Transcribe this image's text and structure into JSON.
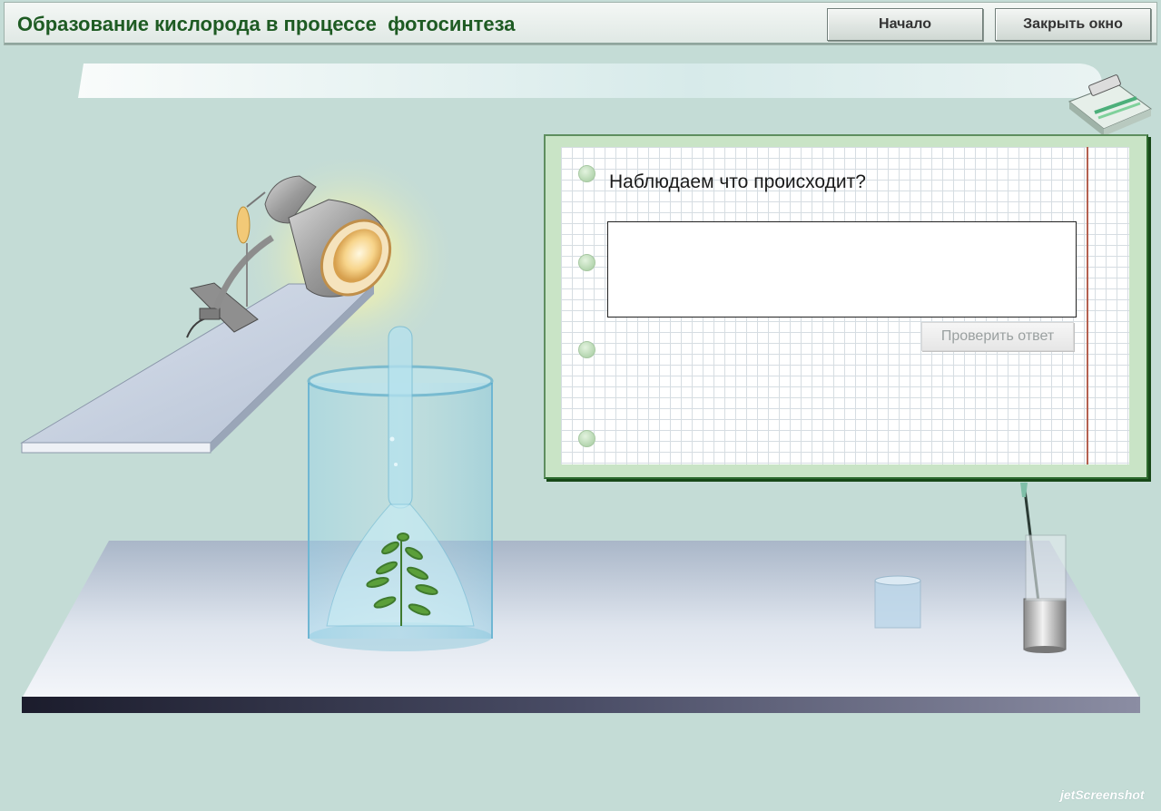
{
  "header": {
    "title": "Образование кислорода в процессе  фотосинтеза",
    "start_label": "Начало",
    "close_label": "Закрыть окно"
  },
  "notebook": {
    "question": "Наблюдаем что происходит?",
    "answer_value": "",
    "check_label": "Проверить ответ",
    "check_enabled": false
  },
  "watermark": "jetScreenshot"
}
